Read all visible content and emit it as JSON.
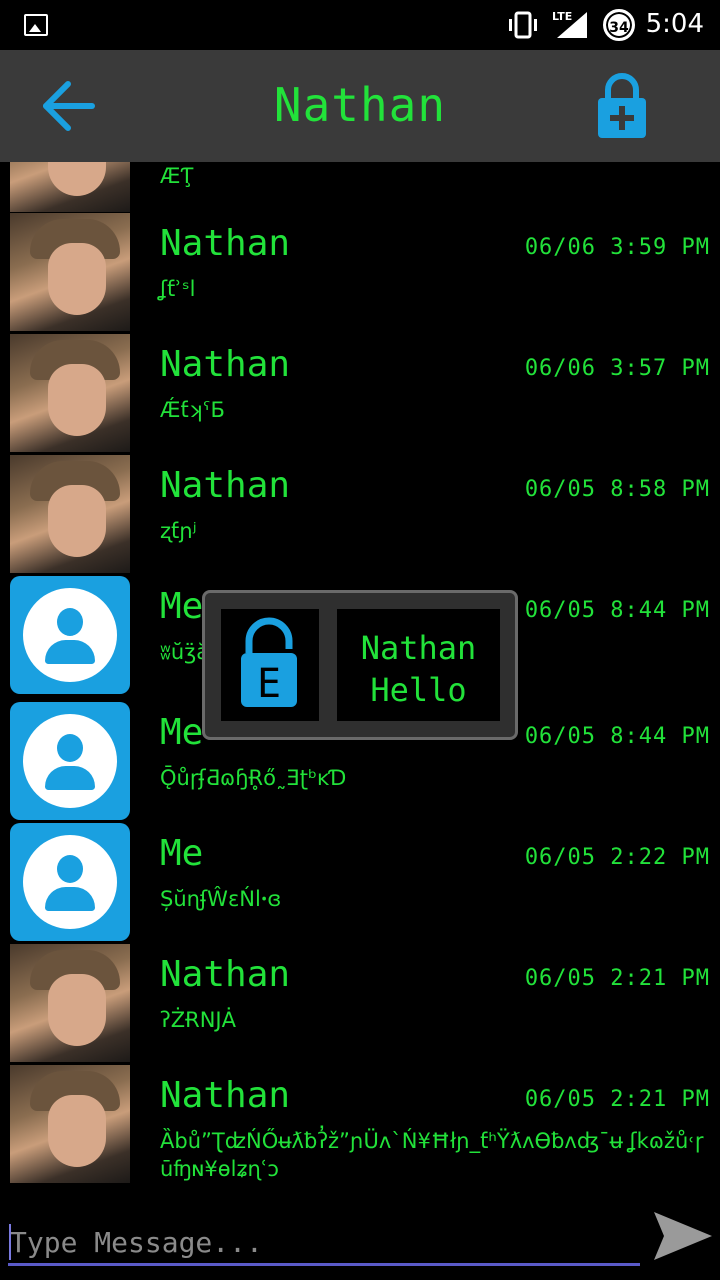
{
  "status_bar": {
    "battery": "34",
    "network": "LTE",
    "time": "5:04",
    "icons": [
      "gallery-icon",
      "vibrate-icon",
      "signal-icon",
      "battery-icon"
    ]
  },
  "toolbar": {
    "title": "Nathan",
    "back_icon": "arrow-left-icon",
    "lock_icon": "lock-plus-icon"
  },
  "colors": {
    "text_green": "#22e23a",
    "accent_blue": "#1aa0e0",
    "toolbar_bg": "#3a3a3a",
    "background": "#000000"
  },
  "messages": [
    {
      "sender": "",
      "time": "",
      "text": "ÆƬ̧",
      "avatar": "photo",
      "partial": true
    },
    {
      "sender": "Nathan",
      "time": "06/06 3:59 PM",
      "text": "ʆƭʾˢl",
      "avatar": "photo"
    },
    {
      "sender": "Nathan",
      "time": "06/06 3:57 PM",
      "text": "ǼƭʞˁБ",
      "avatar": "photo"
    },
    {
      "sender": "Nathan",
      "time": "06/05 8:58 PM",
      "text": "ʐƭɲʲ",
      "avatar": "photo"
    },
    {
      "sender": "Me",
      "time": "06/05 8:44 PM",
      "text": "ʬŭʒ̈ăĝ ƈ ʉ ũŜʜƁŬˀŴʰǤĽɭǝû ɯ˛",
      "avatar": "me"
    },
    {
      "sender": "Me",
      "time": "06/05 8:44 PM",
      "text": "ǬůɼʄƋɷɧɌ̥ő˷ƎʈᵇĸƊ",
      "avatar": "me"
    },
    {
      "sender": "Me",
      "time": "06/05 2:22 PM",
      "text": "ȘŭɳʄŴɛŃlꞏɞ",
      "avatar": "me"
    },
    {
      "sender": "Nathan",
      "time": "06/05 2:21 PM",
      "text": "ʔŻɌNJȦ",
      "avatar": "photo"
    },
    {
      "sender": "Nathan",
      "time": "06/05 2:21 PM",
      "text": "ȀbůˮƮʣŃŐʉƛƀʔ̓žˮɲÜʌˋŃ¥Ħłɲ_ƭʰŸƛʌϴƀʌʤˉʉ ʆkɷžů˓ɼūʩɴ¥ɵlʑɳʿↄ",
      "avatar": "photo"
    }
  ],
  "popup": {
    "icon": "encrypt-lock-icon",
    "icon_letter": "E",
    "line1": "Nathan",
    "line2": "Hello"
  },
  "composer": {
    "placeholder": "Type Message...",
    "value": "",
    "send_icon": "send-icon"
  }
}
